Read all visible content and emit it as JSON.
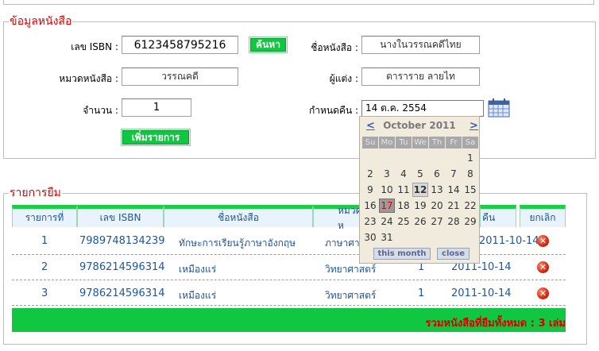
{
  "book_info": {
    "legend": "ข้อมูลหนังสือ",
    "isbn_label": "เลข ISBN :",
    "isbn_value": "6123458795216",
    "search_button": "ค้นหา",
    "title_label": "ชื่อหนังสือ :",
    "title_value": "นางในวรรณคดีไทย",
    "category_label": "หมวดหนังสือ :",
    "category_value": "วรรณคดี",
    "author_label": "ผู้แต่ง :",
    "author_value": "ตาราราย ลายไท",
    "qty_label": "จำนวน :",
    "qty_value": "1",
    "due_label": "กำหนดคืน :",
    "due_value": "14 ต.ค. 2554",
    "add_button": "เพิ่มรายการ"
  },
  "calendar": {
    "prev": "<",
    "next": ">",
    "month_title": "October 2011",
    "weekdays": [
      "Su",
      "Mo",
      "Tu",
      "We",
      "Th",
      "Fr",
      "Sa"
    ],
    "days": [
      "1",
      "2",
      "3",
      "4",
      "5",
      "6",
      "7",
      "8",
      "9",
      "10",
      "11",
      "12",
      "13",
      "14",
      "15",
      "16",
      "17",
      "18",
      "19",
      "20",
      "21",
      "22",
      "23",
      "24",
      "25",
      "26",
      "27",
      "28",
      "29",
      "30",
      "31"
    ],
    "today_day": "12",
    "selected_day": "17",
    "this_month": "this month",
    "close": "close"
  },
  "loan_list": {
    "legend": "รายการยืม",
    "headers": [
      "รายการที่",
      "เลข ISBN",
      "ชื่อหนังสือ",
      "หมวดห",
      "คืน",
      "ยกเลิก"
    ],
    "rows": [
      {
        "no": "1",
        "isbn": "7989748134239",
        "title": "ทักษะการเรียนรู้ภาษาอังกฤษ",
        "category": "ภาษาศา",
        "qty": "1",
        "due": "2011-10-14"
      },
      {
        "no": "2",
        "isbn": "9786214596314",
        "title": "เหมืองแร่",
        "category": "วิทยาศาสตร์",
        "qty": "1",
        "due": "2011-10-14"
      },
      {
        "no": "3",
        "isbn": "9786214596314",
        "title": "เหมืองแร่",
        "category": "วิทยาศาสตร์",
        "qty": "1",
        "due": "2011-10-14"
      }
    ],
    "total_text": "รวมหนังสือที่ยืมทั้งหมด : 3 เล่ม"
  },
  "icons": {
    "delete": "delete-icon",
    "calendar": "calendar-icon"
  },
  "colors": {
    "accent_green": "#11c742",
    "legend_red": "#e00000",
    "link_blue": "#1e56a0"
  }
}
